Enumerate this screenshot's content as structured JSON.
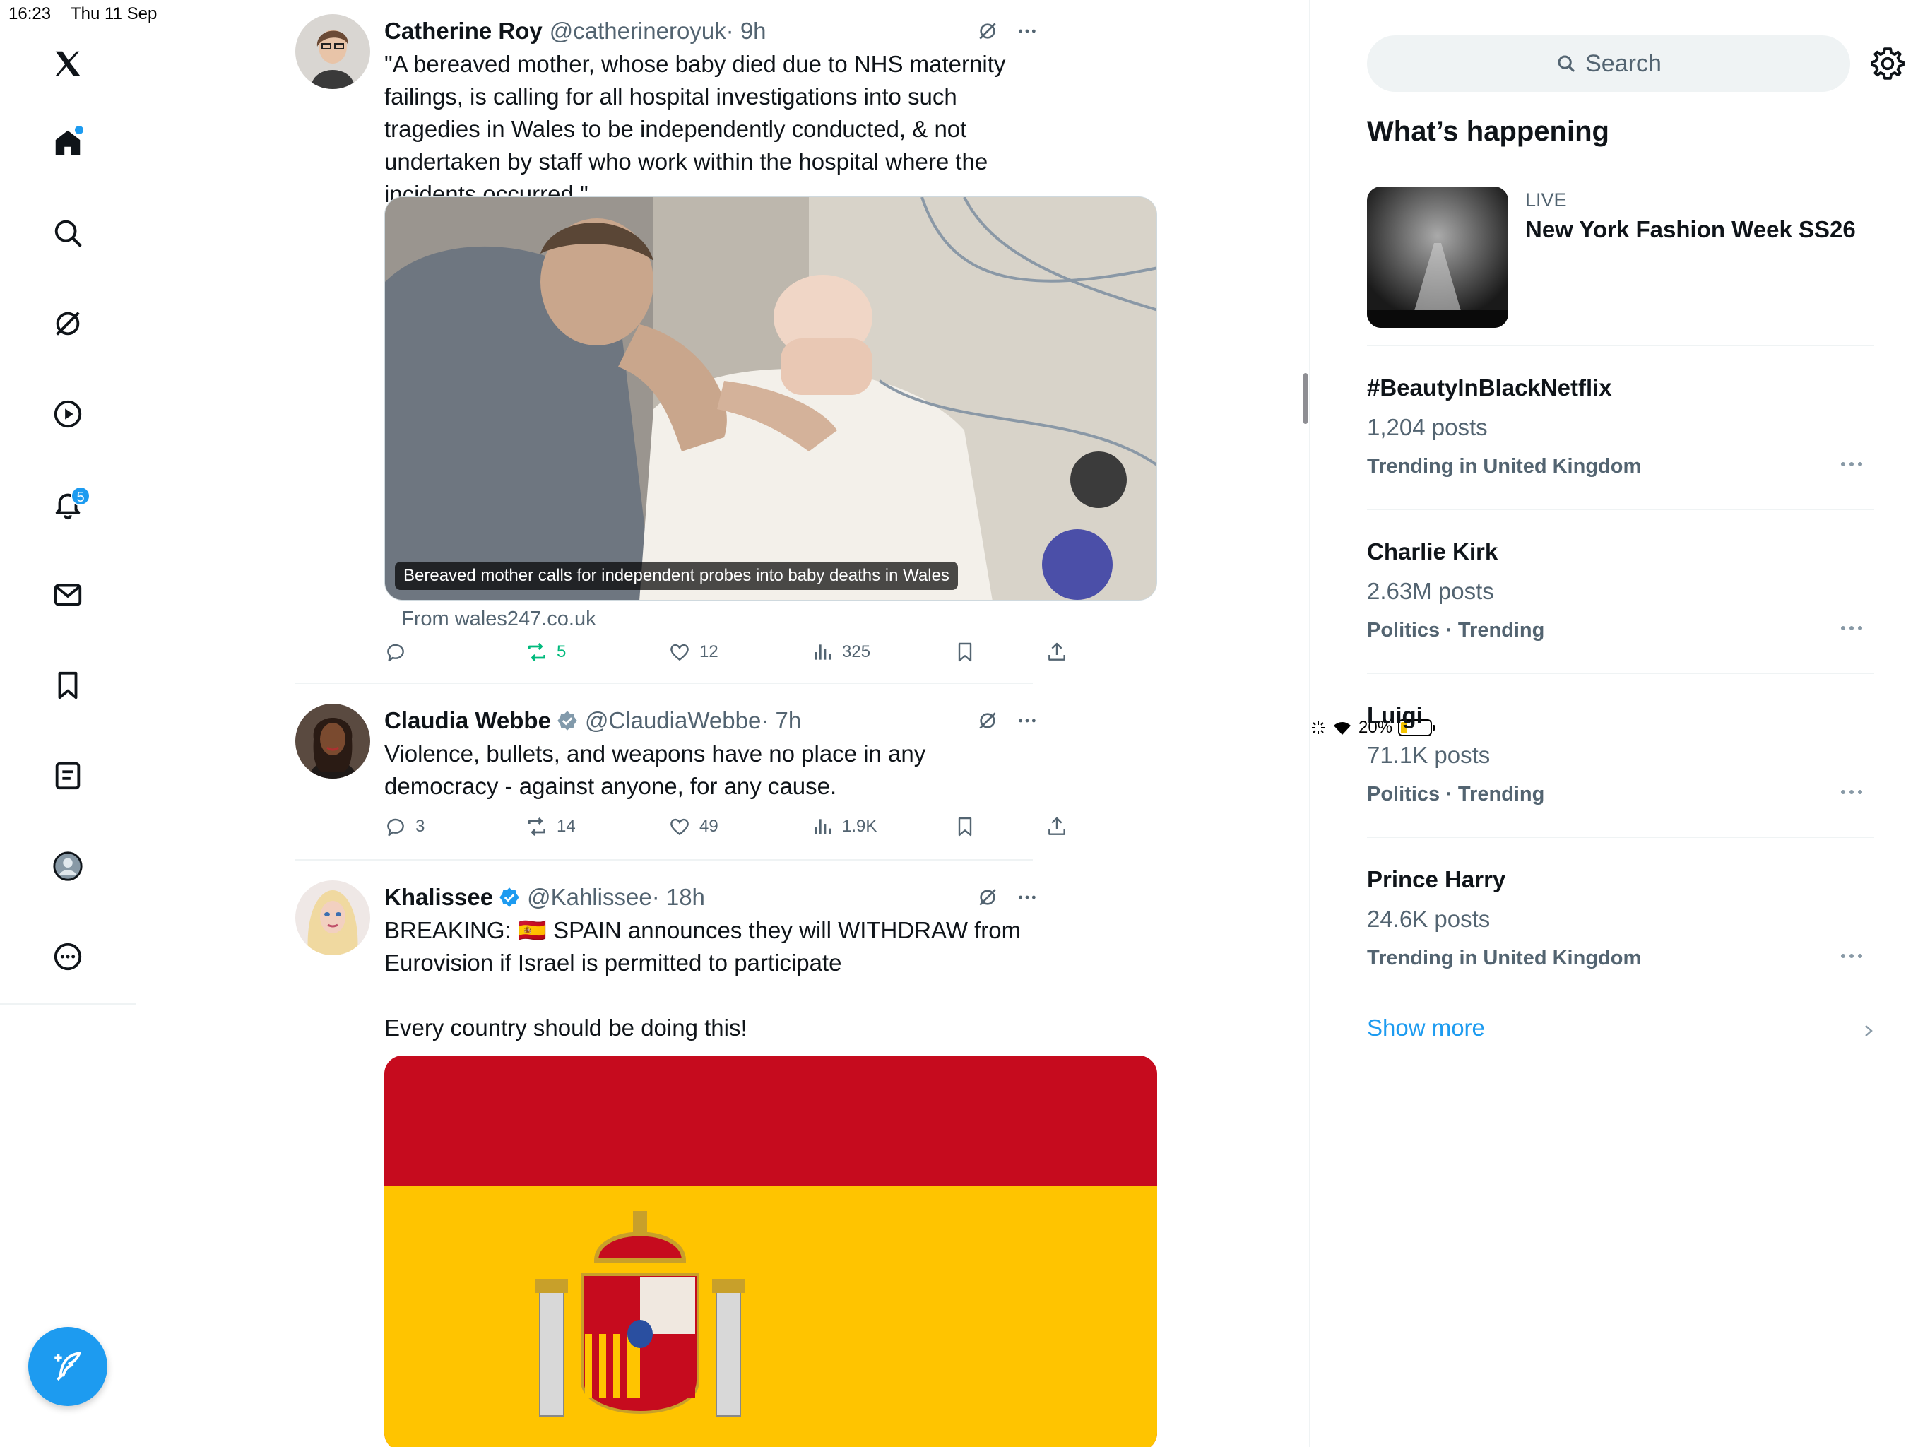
{
  "status_bar": {
    "time": "16:23",
    "date": "Thu 11 Sep",
    "battery": "20%"
  },
  "nav": {
    "notifications_badge": "5",
    "items": [
      "x-logo-icon",
      "home-icon",
      "search-icon",
      "grok-icon",
      "video-icon",
      "notifications-icon",
      "messages-icon",
      "bookmarks-icon",
      "lists-icon",
      "profile-icon",
      "more-icon"
    ]
  },
  "tweets": [
    {
      "name": "Catherine Roy",
      "handle": "@catherineroyuk",
      "time": "· 9h",
      "text": "\"A bereaved mother, whose baby died due to NHS maternity failings, is calling for all hospital investigations into such tragedies in Wales to be independently conducted, & not undertaken by staff who work within the hospital where the incidents occurred.\"",
      "media_caption": "Bereaved mother calls for independent probes into baby deaths in Wales",
      "source": "From wales247.co.uk",
      "replies": "",
      "reposts": "5",
      "likes": "12",
      "views": "325"
    },
    {
      "name": "Claudia Webbe",
      "handle": "@ClaudiaWebbe",
      "time": "· 7h",
      "text": "Violence, bullets, and weapons have no place in any democracy - against anyone, for any cause.",
      "replies": "3",
      "reposts": "14",
      "likes": "49",
      "views": "1.9K"
    },
    {
      "name": "Khalissee",
      "handle": "@Kahlissee",
      "time": "· 18h",
      "text_line1": "BREAKING: 🇪🇸 SPAIN announces they will WITHDRAW from Eurovision if Israel is permitted to participate",
      "text_line2": "Every country should be doing this!"
    }
  ],
  "sidebar": {
    "search_placeholder": "Search",
    "section_title": "What’s happening",
    "live": {
      "label": "LIVE",
      "title": "New York Fashion Week SS26"
    },
    "trends": [
      {
        "name": "#BeautyInBlackNetflix",
        "posts": "1,204 posts",
        "context": "Trending in United Kingdom"
      },
      {
        "name": "Charlie Kirk",
        "posts": "2.63M posts",
        "context": "Politics · Trending"
      },
      {
        "name": "Luigi",
        "posts": "71.1K posts",
        "context": "Politics · Trending"
      },
      {
        "name": "Prince Harry",
        "posts": "24.6K posts",
        "context": "Trending in United Kingdom"
      }
    ],
    "show_more": "Show more"
  },
  "colors": {
    "accent": "#1d9bf0",
    "repost_active": "#00ba7c",
    "text_primary": "#0f1419",
    "text_secondary": "#536471",
    "divider": "#eff3f4"
  }
}
